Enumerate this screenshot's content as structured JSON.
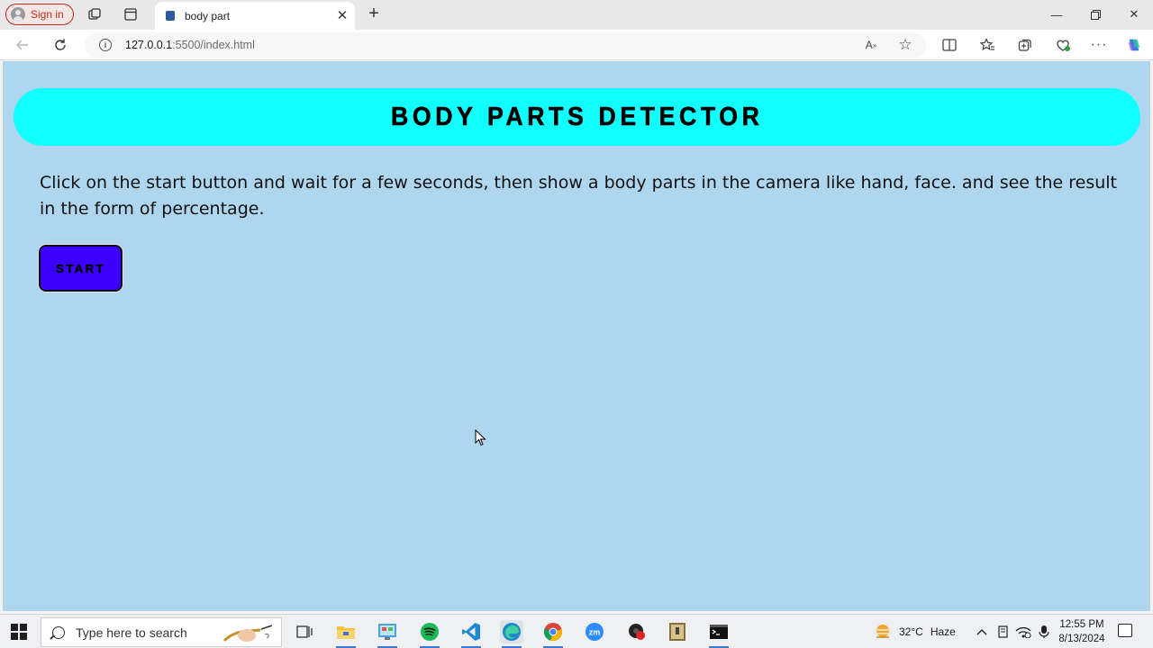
{
  "browser": {
    "sign_in_label": "Sign in",
    "tab_title": "body part",
    "url_host": "127.0.0.1",
    "url_path": ":5500/index.html"
  },
  "page": {
    "header_title": "BODY PARTS DETECTOR",
    "instructions": "Click on the start button and wait for a few seconds, then show a body parts in the camera like hand, face. and see the result in the form of percentage.",
    "start_button_label": "START",
    "colors": {
      "page_bg": "#aed6ee",
      "header_bg": "#12ffff",
      "start_bg": "#3c00ff"
    }
  },
  "taskbar": {
    "search_placeholder": "Type here to search",
    "weather_temp": "32°C",
    "weather_desc": "Haze",
    "time": "12:55 PM",
    "date": "8/13/2024"
  }
}
